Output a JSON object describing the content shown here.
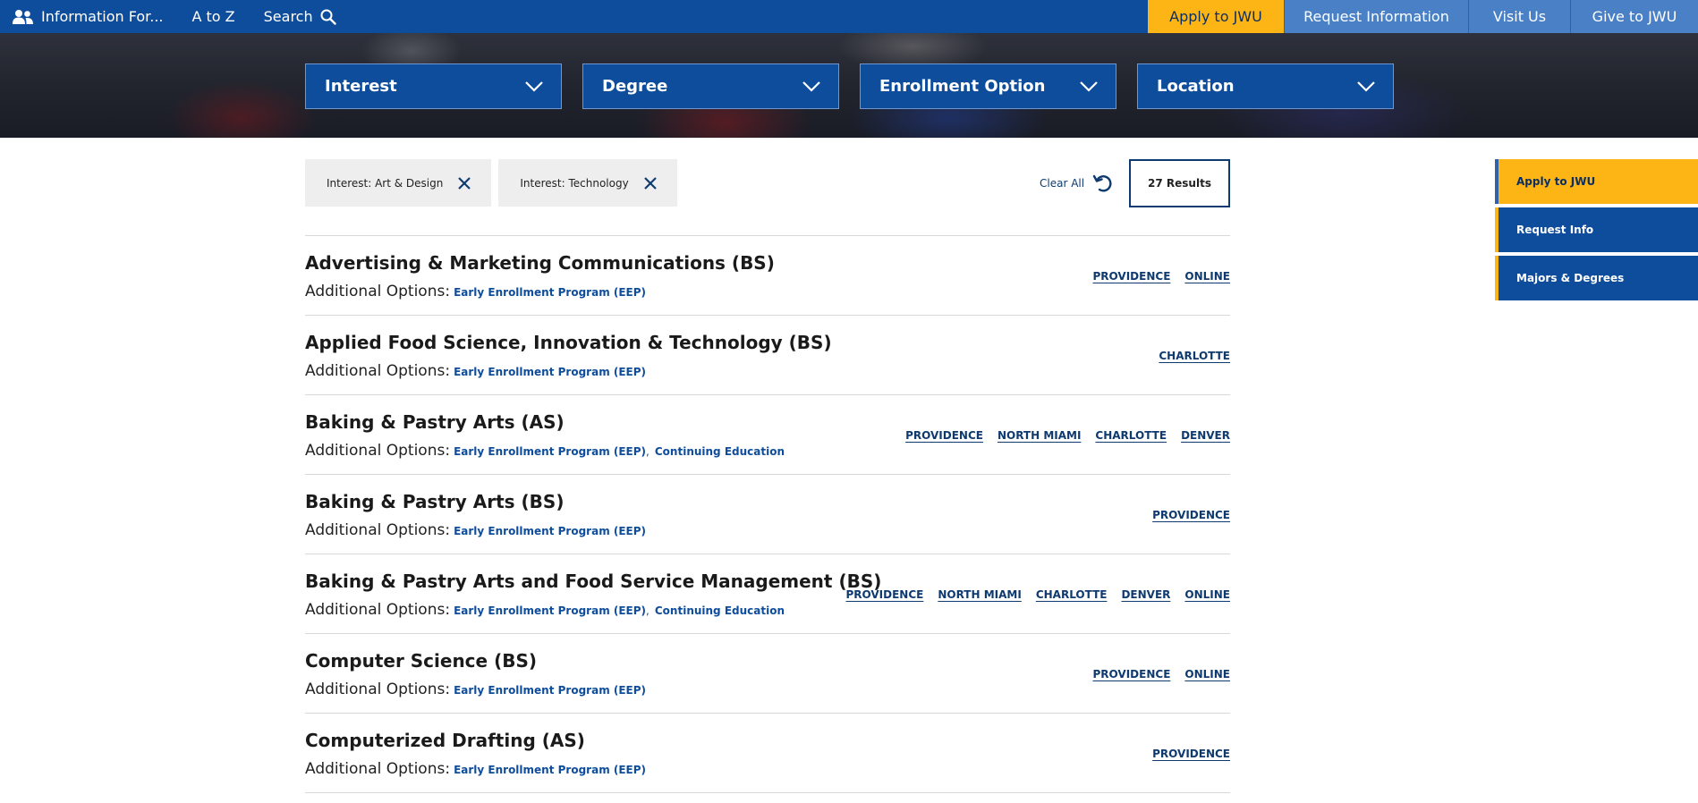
{
  "topnav": {
    "info_label": "Information For...",
    "az_label": "A to Z",
    "search_label": "Search"
  },
  "topbuttons": {
    "apply": "Apply to JWU",
    "request": "Request Information",
    "visit": "Visit Us",
    "give": "Give to JWU"
  },
  "filters": {
    "interest": "Interest",
    "degree": "Degree",
    "enrollment": "Enrollment Option",
    "location": "Location"
  },
  "chips": [
    {
      "label": "Interest: Art & Design"
    },
    {
      "label": "Interest: Technology"
    }
  ],
  "clear_all": "Clear All",
  "results": "27 Results",
  "options_prefix": "Additional Options:",
  "programs": [
    {
      "title": "Advertising & Marketing Communications (BS)",
      "options": [
        "Early Enrollment Program (EEP)"
      ],
      "locations": [
        "PROVIDENCE",
        "ONLINE"
      ]
    },
    {
      "title": "Applied Food Science, Innovation & Technology (BS)",
      "options": [
        "Early Enrollment Program (EEP)"
      ],
      "locations": [
        "CHARLOTTE"
      ]
    },
    {
      "title": "Baking & Pastry Arts (AS)",
      "options": [
        "Early Enrollment Program (EEP)",
        "Continuing Education"
      ],
      "locations": [
        "PROVIDENCE",
        "NORTH MIAMI",
        "CHARLOTTE",
        "DENVER"
      ]
    },
    {
      "title": "Baking & Pastry Arts (BS)",
      "options": [
        "Early Enrollment Program (EEP)"
      ],
      "locations": [
        "PROVIDENCE"
      ]
    },
    {
      "title": "Baking & Pastry Arts and Food Service Management (BS)",
      "options": [
        "Early Enrollment Program (EEP)",
        "Continuing Education"
      ],
      "locations": [
        "PROVIDENCE",
        "NORTH MIAMI",
        "CHARLOTTE",
        "DENVER",
        "ONLINE"
      ]
    },
    {
      "title": "Computer Science (BS)",
      "options": [
        "Early Enrollment Program (EEP)"
      ],
      "locations": [
        "PROVIDENCE",
        "ONLINE"
      ]
    },
    {
      "title": "Computerized Drafting (AS)",
      "options": [
        "Early Enrollment Program (EEP)"
      ],
      "locations": [
        "PROVIDENCE"
      ]
    }
  ],
  "side_tabs": {
    "apply": "Apply to JWU",
    "request": "Request Info",
    "majors": "Majors & Degrees"
  },
  "colors": {
    "primary_blue": "#0e4d9c",
    "light_blue": "#4a80c6",
    "gold": "#fdb515",
    "navy_text": "#0e3a70"
  }
}
